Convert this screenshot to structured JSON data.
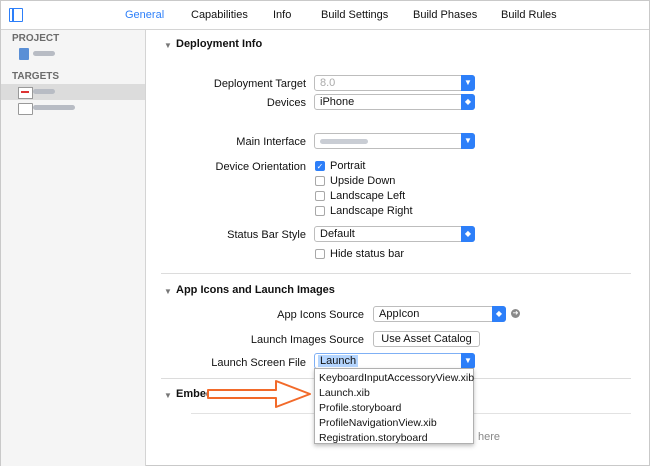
{
  "tabs": [
    {
      "label": "General",
      "active": true
    },
    {
      "label": "Capabilities"
    },
    {
      "label": "Info"
    },
    {
      "label": "Build Settings"
    },
    {
      "label": "Build Phases"
    },
    {
      "label": "Build Rules"
    }
  ],
  "sidebar": {
    "project_heading": "PROJECT",
    "targets_heading": "TARGETS"
  },
  "deployment": {
    "title": "Deployment Info",
    "target_label": "Deployment Target",
    "target_value": "8.0",
    "devices_label": "Devices",
    "devices_value": "iPhone",
    "main_interface_label": "Main Interface",
    "orientation_label": "Device Orientation",
    "orientations": [
      {
        "label": "Portrait",
        "checked": true
      },
      {
        "label": "Upside Down",
        "checked": false
      },
      {
        "label": "Landscape Left",
        "checked": false
      },
      {
        "label": "Landscape Right",
        "checked": false
      }
    ],
    "status_bar_label": "Status Bar Style",
    "status_bar_value": "Default",
    "hide_status_bar": "Hide status bar"
  },
  "app_icons": {
    "title": "App Icons and Launch Images",
    "icons_source_label": "App Icons Source",
    "icons_source_value": "AppIcon",
    "launch_images_label": "Launch Images Source",
    "launch_images_button": "Use Asset Catalog",
    "launch_screen_label": "Launch Screen File",
    "launch_screen_value": "Launch",
    "options": [
      "KeyboardInputAccessoryView.xib",
      "Launch.xib",
      "Profile.storyboard",
      "ProfileNavigationView.xib",
      "Registration.storyboard"
    ]
  },
  "embedded": {
    "title": "Embedded Binaries",
    "hint_fragment": "here"
  },
  "colors": {
    "accent": "#2d7ff9",
    "annotation_arrow": "#f26a2a"
  }
}
